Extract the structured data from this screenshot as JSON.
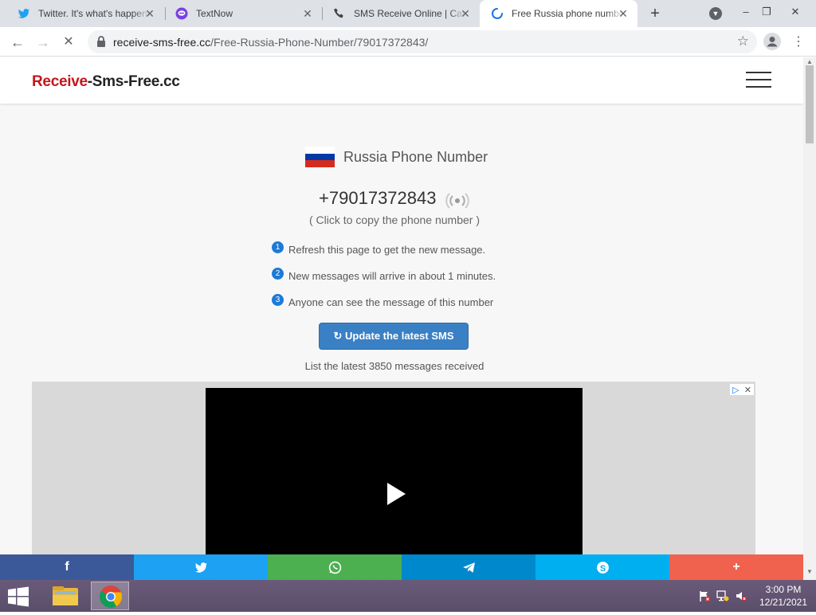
{
  "browser": {
    "tabs": [
      {
        "title": "Twitter. It's what's happening",
        "icon": "twitter-icon",
        "active": false
      },
      {
        "title": "TextNow",
        "icon": "textnow-icon",
        "active": false
      },
      {
        "title": "SMS Receive Online | Car",
        "icon": "phone-icon",
        "active": false
      },
      {
        "title": "Free Russia phone numbe",
        "icon": "loading-spinner-icon",
        "active": true
      }
    ],
    "new_tab_label": "+",
    "address": {
      "domain": "receive-sms-free.cc",
      "path": "/Free-Russia-Phone-Number/79017372843/"
    },
    "window_controls": {
      "minimize": "–",
      "restore": "❐",
      "close": "✕"
    }
  },
  "site": {
    "logo_part1": "Receive",
    "logo_part2": "-Sms-Free.cc",
    "country_title": "Russia Phone Number",
    "flag_colors": [
      "#ffffff",
      "#0039a6",
      "#d52b1e"
    ],
    "phone_number": "+79017372843",
    "copy_hint": "( Click to copy the phone number )",
    "steps": [
      {
        "num": "1",
        "text": "Refresh this page to get the new message."
      },
      {
        "num": "2",
        "text": "New messages will arrive in about 1 minutes."
      },
      {
        "num": "3",
        "text": "Anyone can see the message of this number"
      }
    ],
    "update_button": "↻ Update the latest SMS",
    "list_caption": "List the latest 3850 messages received",
    "accent_color": "#3a80c4"
  },
  "sharebar": [
    {
      "name": "facebook",
      "glyph": "f",
      "color": "#3b5998"
    },
    {
      "name": "twitter",
      "glyph": "🐦",
      "color": "#1da1f2"
    },
    {
      "name": "whatsapp",
      "glyph": "✆",
      "color": "#4caf50"
    },
    {
      "name": "telegram",
      "glyph": "➤",
      "color": "#0088cc"
    },
    {
      "name": "skype",
      "glyph": "S",
      "color": "#00aff0"
    },
    {
      "name": "more",
      "glyph": "+",
      "color": "#f0614e"
    }
  ],
  "taskbar": {
    "time": "3:00 PM",
    "date": "12/21/2021"
  }
}
